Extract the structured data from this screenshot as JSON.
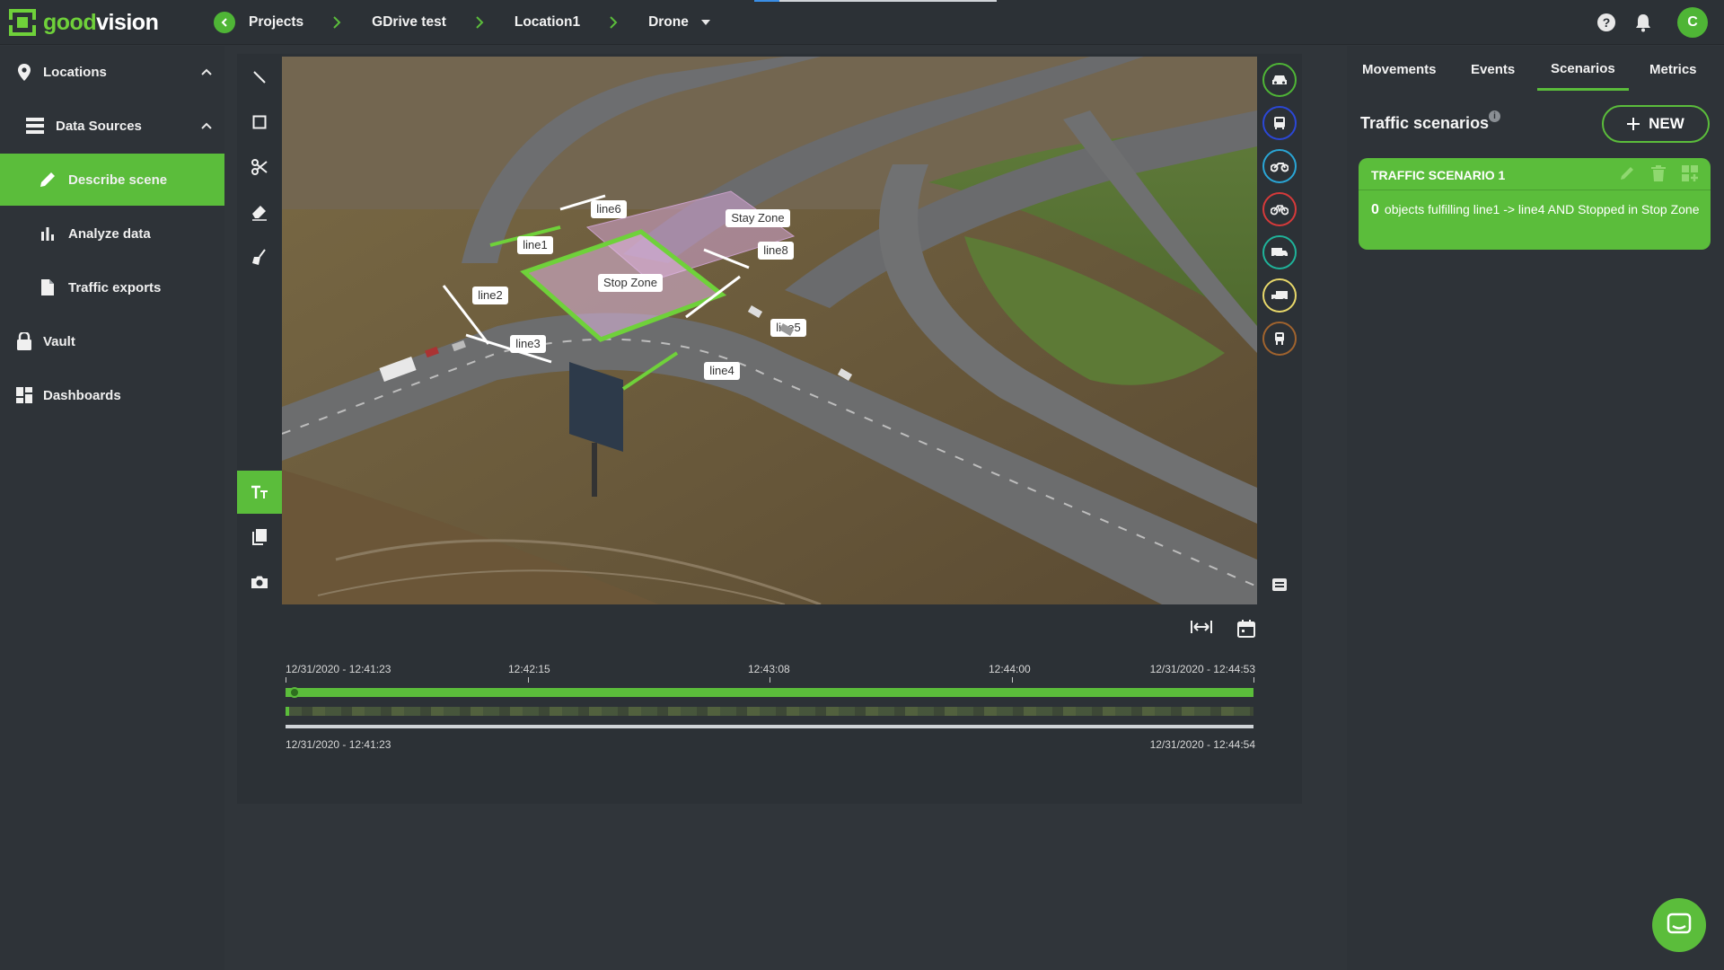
{
  "app": {
    "logo_part1": "good",
    "logo_part2": "vision"
  },
  "breadcrumb": [
    "Projects",
    "GDrive test",
    "Location1",
    "Drone"
  ],
  "user": {
    "initial": "C"
  },
  "sidebar": {
    "items": [
      {
        "label": "Locations"
      },
      {
        "label": "Data Sources"
      },
      {
        "label": "Describe scene"
      },
      {
        "label": "Analyze data"
      },
      {
        "label": "Traffic exports"
      },
      {
        "label": "Vault"
      },
      {
        "label": "Dashboards"
      }
    ]
  },
  "scene": {
    "lines": [
      "line1",
      "line2",
      "line3",
      "line4",
      "line5",
      "line6",
      "line8"
    ],
    "zones": [
      "Stop Zone",
      "Stay Zone"
    ]
  },
  "object_classes": [
    {
      "name": "car-icon",
      "color": "#4fb536"
    },
    {
      "name": "bus-icon",
      "color": "#2b47d6"
    },
    {
      "name": "motorcycle-icon",
      "color": "#2aa6d6"
    },
    {
      "name": "bicycle-icon",
      "color": "#d63a3a"
    },
    {
      "name": "van-icon",
      "color": "#1fb39a"
    },
    {
      "name": "truck-icon",
      "color": "#e8d86a"
    },
    {
      "name": "pedestrian-icon",
      "color": "#a0632e"
    }
  ],
  "timeline": {
    "ticks": [
      "12/31/2020 - 12:41:23",
      "12:42:15",
      "12:43:08",
      "12:44:00",
      "12/31/2020 - 12:44:53"
    ],
    "range_start": "12/31/2020 - 12:41:23",
    "range_end": "12/31/2020 - 12:44:54"
  },
  "right_panel": {
    "tabs": [
      "Movements",
      "Events",
      "Scenarios",
      "Metrics"
    ],
    "active_tab": "Scenarios",
    "title": "Traffic scenarios",
    "info": "i",
    "new_button": "NEW",
    "scenario": {
      "name": "TRAFFIC SCENARIO 1",
      "count": "0",
      "description": "objects fulfilling line1 -> line4 AND Stopped in Stop Zone"
    }
  },
  "colors": {
    "accent": "#5bbd3b",
    "background": "#30353a"
  }
}
